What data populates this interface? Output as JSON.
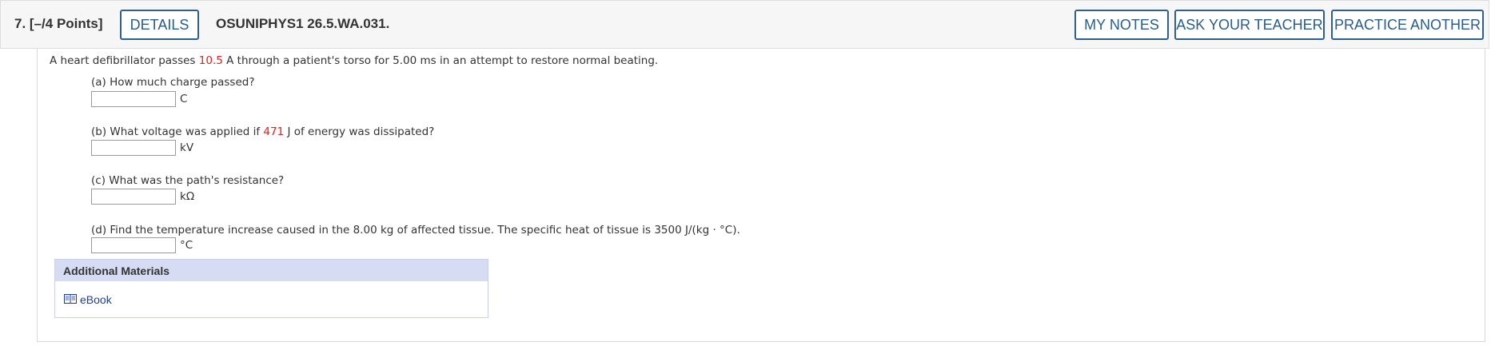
{
  "header": {
    "question_number": "7.",
    "points": "[–/4 Points]",
    "details_label": "DETAILS",
    "question_id": "OSUNIPHYS1 26.5.WA.031.",
    "my_notes_label": "MY NOTES",
    "ask_teacher_label": "ASK YOUR TEACHER",
    "practice_another_label": "PRACTICE ANOTHER"
  },
  "problem": {
    "intro_before": "A heart defibrillator passes ",
    "current_value": "10.5",
    "intro_after": " A through a patient's torso for 5.00 ms in an attempt to restore normal beating."
  },
  "parts": {
    "a": {
      "question": "(a) How much charge passed?",
      "value": "",
      "unit": "C"
    },
    "b": {
      "question_before": "(b) What voltage was applied if ",
      "energy_value": "471",
      "question_after": " J of energy was dissipated?",
      "value": "",
      "unit": "kV"
    },
    "c": {
      "question": "(c) What was the path's resistance?",
      "value": "",
      "unit": "kΩ"
    },
    "d": {
      "question": "(d) Find the temperature increase caused in the 8.00 kg of affected tissue. The specific heat of tissue is 3500 J/(kg · °C).",
      "value": "",
      "unit": "°C"
    }
  },
  "additional_materials": {
    "heading": "Additional Materials",
    "link_label": "eBook",
    "link_icon": "book-icon"
  },
  "colors": {
    "button_border": "#2f5f8f",
    "button_text": "#2a5d8c",
    "highlight_red": "#e0201c",
    "materials_header_bg": "#d6dcf3",
    "link_blue": "#1f3f9a"
  }
}
